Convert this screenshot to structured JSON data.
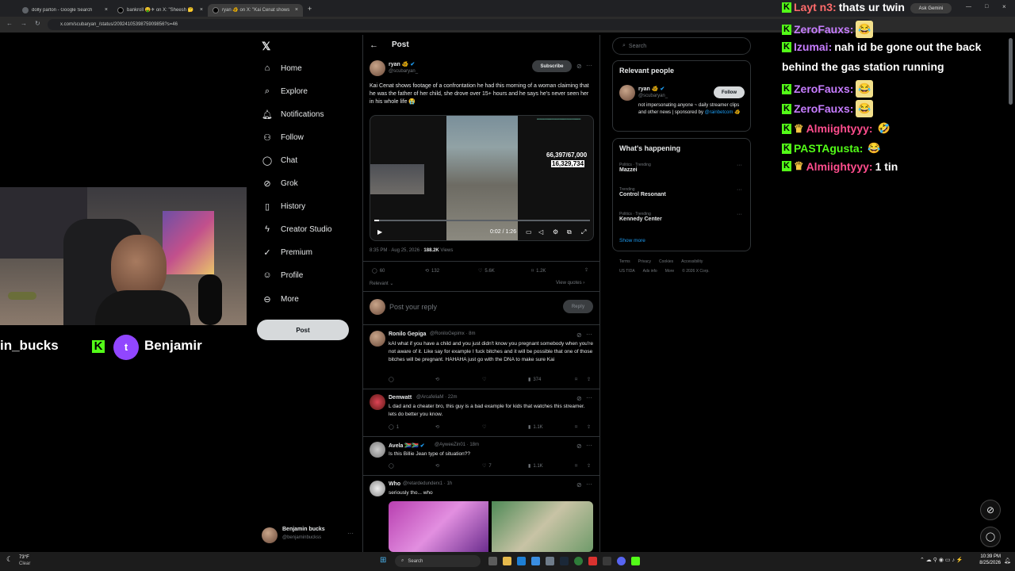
{
  "browser": {
    "tabs": [
      {
        "title": "dolly parton - Google Search"
      },
      {
        "title": "bankroll 🤑✈ on X: \"Sheesh 🤔"
      },
      {
        "title": "ryan 🐠 on X: \"Kai Cenat shows"
      }
    ],
    "url": "x.com/scubaryan_/status/2092410539875909856?s=46",
    "ask_gemini": "Ask Gemini"
  },
  "nav": {
    "items": [
      "Home",
      "Explore",
      "Notifications",
      "Follow",
      "Chat",
      "Grok",
      "History",
      "Creator Studio",
      "Premium",
      "Profile",
      "More"
    ],
    "post_button": "Post",
    "account": {
      "name": "Benjamin bucks",
      "handle": "@benjaminbuckss"
    }
  },
  "header": {
    "title": "Post"
  },
  "post": {
    "author": "ryan 🐠",
    "handle": "@scubaryan_",
    "subscribe": "Subscribe",
    "text": "Kai Cenat shows footage of a confrontation he had this morning of a woman claiming that he was the father of her child, she drove over 15+ hours and he says he's never seen her in his whole life 😭",
    "video": {
      "time": "0:02 / 1:26",
      "overlay_count_1": "66,397/67,000",
      "overlay_count_2": "16,329,734"
    },
    "date": "8:35 PM · Aug 25, 2026 · ",
    "views": "188.2K",
    "views_label": "Views",
    "stats": {
      "replies": "60",
      "reposts": "132",
      "likes": "5.6K",
      "bookmarks": "1.2K"
    },
    "relevant": "Relevant",
    "view_quotes": "View quotes",
    "reply_placeholder": "Post your reply",
    "reply_button": "Reply"
  },
  "replies": [
    {
      "name": "Ronilo Gepiga",
      "meta": "@RoniloGepimx · 8m",
      "text": "kAI what if you have a child and you just didn't know you pregnant somebody when you're not aware of it. Like say for example I fuck bitches and it will be possible that one of those bitches will be pregnant. HAHAHA just go with the DNA to make sure Kai",
      "replies": "",
      "likes": "",
      "views": "374"
    },
    {
      "name": "Demwatt",
      "meta": "@ArcafeliaM · 22m",
      "text": "L dad and a cheater bro, this guy is a bad example for kids that watches this streamer. lets do better you know.",
      "replies": "1",
      "likes": "",
      "views": "1.1K"
    },
    {
      "name": "Avela 🇿🇦🇿🇦",
      "meta": "@AyweeZin01 · 18m",
      "text": "Is this Billie Jean type of situation??",
      "replies": "",
      "likes": "7",
      "views": "1.1K"
    },
    {
      "name": "Who",
      "meta": "@retardedunderx1 · 1h",
      "text": "seriously tho... who",
      "replies": "",
      "likes": "",
      "views": ""
    }
  ],
  "right": {
    "search_placeholder": "Search",
    "relevant_people": {
      "title": "Relevant people",
      "name": "ryan 🐠",
      "handle": "@scubaryan_",
      "follow": "Follow",
      "bio": "not impersonating anyone ~ daily streamer clips and other news | sponsored by ",
      "bio_link": "@rainbetcom 🐠"
    },
    "happening": {
      "title": "What's happening",
      "items": [
        {
          "context": "Politics · Trending",
          "topic": "Mazzei"
        },
        {
          "context": "Trending",
          "topic": "Control Resonant"
        },
        {
          "context": "Politics · Trending",
          "topic": "Kennedy Center"
        }
      ],
      "show_more": "Show more"
    },
    "footer_1": [
      "Terms",
      "Privacy",
      "Cookies",
      "Accessibility"
    ],
    "footer_2": [
      "US TIDA",
      "Ads info",
      "More",
      "© 2026 X Corp."
    ]
  },
  "chat": [
    {
      "user": "Layt n3:",
      "user_color": "#ff6b6b",
      "msg": "thats ur twin",
      "emote": "",
      "badge": false
    },
    {
      "user": "ZeroFauxs:",
      "user_color": "#c77dff",
      "msg": "",
      "emote": "😂",
      "badge": false
    },
    {
      "user": "Izumai:",
      "user_color": "#c77dff",
      "msg": "nah id be gone out the back",
      "emote": "",
      "badge": false
    },
    {
      "user": "",
      "user_color": "#ffffff",
      "msg": "behind the gas station running",
      "emote": "",
      "badge": false
    },
    {
      "user": "ZeroFauxs:",
      "user_color": "#c77dff",
      "msg": "",
      "emote": "😂",
      "badge": false
    },
    {
      "user": "ZeroFauxs:",
      "user_color": "#c77dff",
      "msg": "",
      "emote": "😂",
      "badge": false
    },
    {
      "user": "Almiightyyy:",
      "user_color": "#ff4d8d",
      "msg": "",
      "emote": "🤣",
      "badge": true
    },
    {
      "user": "PASTAgusta:",
      "user_color": "#53fc18",
      "msg": "",
      "emote": "😂",
      "badge": false
    },
    {
      "user": "Almiightyyy:",
      "user_color": "#ff4d8d",
      "msg": "1 tin",
      "emote": "",
      "badge": true
    }
  ],
  "stream": {
    "left_name": "in_bucks",
    "twitch_name": "Benjamir"
  },
  "taskbar": {
    "weather_temp": "73°F",
    "weather_desc": "Clear",
    "search": "Search",
    "time": "10:39 PM",
    "date": "8/25/2026"
  }
}
